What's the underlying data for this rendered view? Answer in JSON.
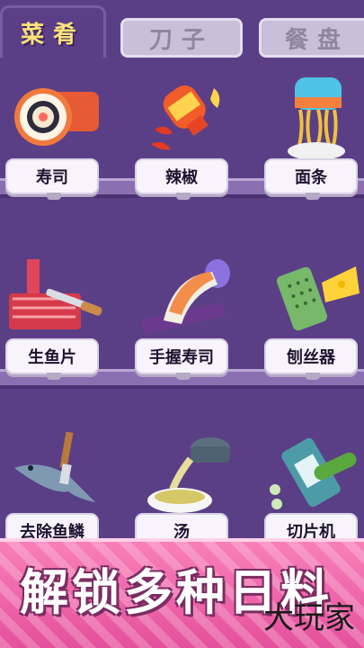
{
  "tabs": [
    {
      "label": "菜肴",
      "active": true
    },
    {
      "label": "刀子",
      "active": false
    },
    {
      "label": "餐盘",
      "active": false
    }
  ],
  "items": [
    {
      "label": "寿司",
      "icon": "sushi-roll-icon"
    },
    {
      "label": "辣椒",
      "icon": "chili-sauce-icon"
    },
    {
      "label": "面条",
      "icon": "noodles-icon"
    },
    {
      "label": "生鱼片",
      "icon": "sashimi-knife-icon"
    },
    {
      "label": "手握寿司",
      "icon": "nigiri-icon"
    },
    {
      "label": "刨丝器",
      "icon": "cheese-grater-icon"
    },
    {
      "label": "去除鱼鳞",
      "icon": "fish-scaling-icon"
    },
    {
      "label": "汤",
      "icon": "soup-pot-icon"
    },
    {
      "label": "切片机",
      "icon": "cucumber-slicer-icon"
    }
  ],
  "banner": {
    "title": "解锁多种日料"
  },
  "watermark": {
    "text": "大玩家"
  },
  "colors": {
    "background": "#5b3f86",
    "banner": "#e5509d",
    "active_tab_text": "#ffe27a"
  }
}
